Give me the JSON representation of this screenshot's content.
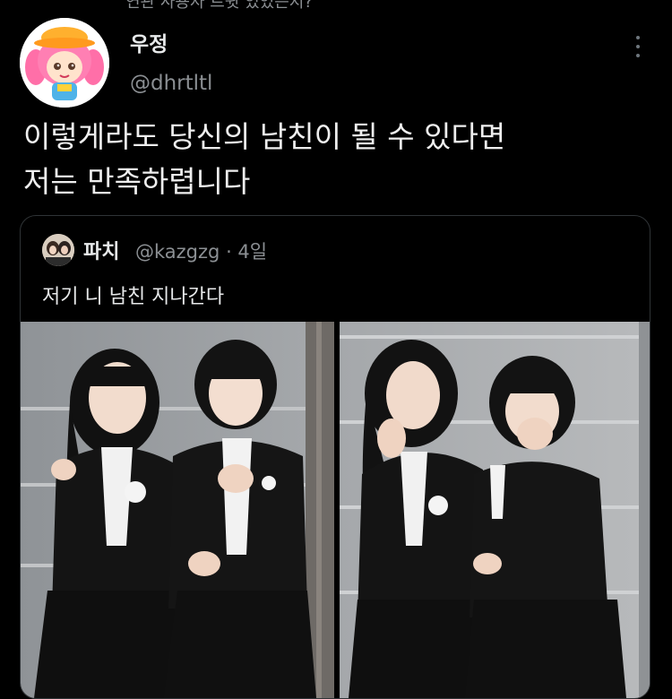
{
  "tweet": {
    "cutoff_text": "연관 사용자 트윗 있었는지?",
    "author_name": "우정",
    "author_handle": "@dhrtltl",
    "text_line1": "이렇게라도 당신의 남친이 될 수 있다면",
    "text_line2": "저는 만족하렵니다"
  },
  "quote": {
    "author_name": "파치",
    "author_handle": "@kazgzg",
    "time": "· 4일",
    "text": "저기 니 남친 지나간다"
  },
  "icons": {
    "more": "more-vertical-icon"
  },
  "colors": {
    "background": "#000000",
    "text_primary": "#e7e9ea",
    "text_secondary": "#8b8f93",
    "border": "#2f3336"
  }
}
